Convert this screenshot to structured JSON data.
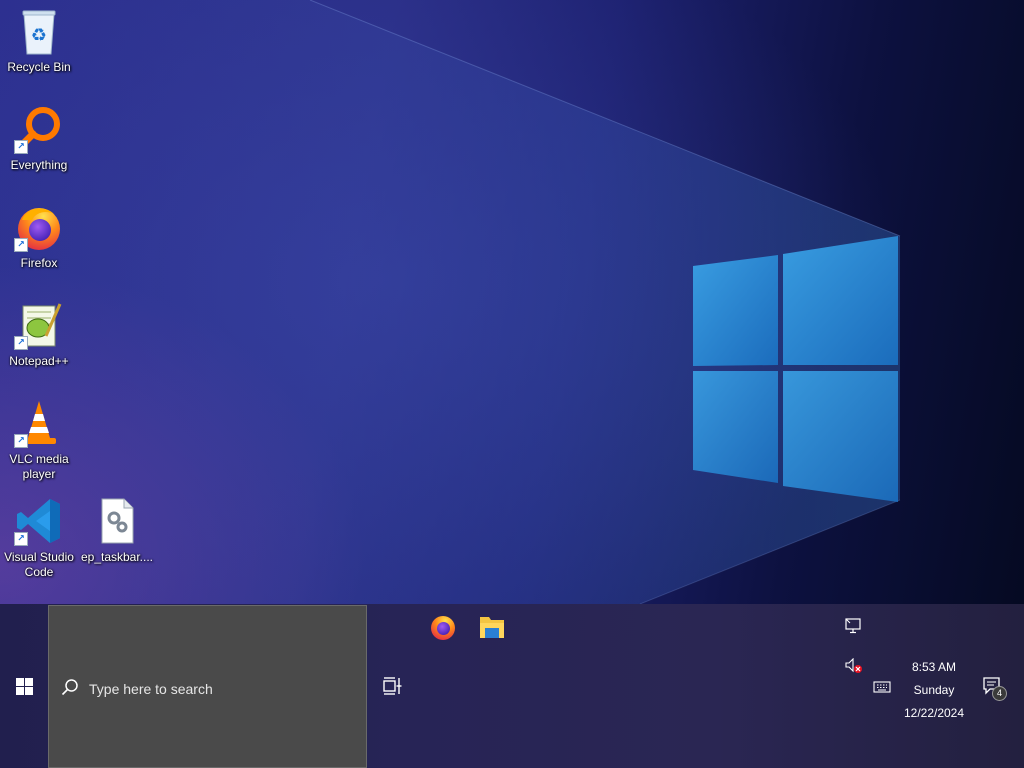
{
  "desktop": {
    "icons": [
      {
        "label": "Recycle Bin",
        "icon": "recycle-bin-icon"
      },
      {
        "label": "Everything",
        "icon": "everything-search-icon"
      },
      {
        "label": "Firefox",
        "icon": "firefox-icon"
      },
      {
        "label": "Notepad++",
        "icon": "notepad-plus-plus-icon"
      },
      {
        "label": "VLC media player",
        "icon": "vlc-cone-icon"
      },
      {
        "label": "Visual Studio Code",
        "icon": "vscode-icon"
      },
      {
        "label": "ep_taskbar....",
        "icon": "settings-file-icon"
      }
    ]
  },
  "taskbar": {
    "search_placeholder": "Type here to search",
    "pinned": [
      {
        "name": "Firefox",
        "icon": "firefox-icon"
      },
      {
        "name": "File Explorer",
        "icon": "folder-icon"
      }
    ],
    "tray": {
      "time": "8:53 AM",
      "day": "Sunday",
      "date": "12/22/2024",
      "notification_count": "4"
    }
  },
  "colors": {
    "taskbar": "#25234f",
    "search_box": "#4a4a4a",
    "windows_logo": "#2d8bd6"
  }
}
